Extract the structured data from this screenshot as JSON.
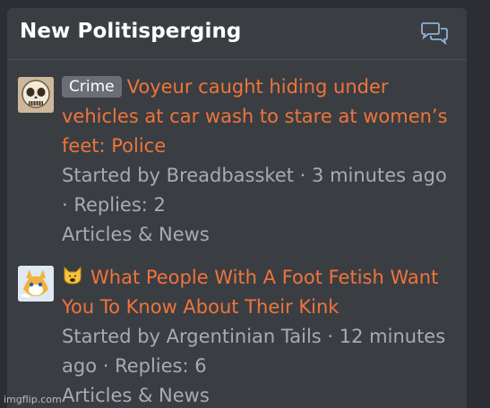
{
  "widget": {
    "title": "New Politisperging",
    "header_icon": "chat-bubbles-icon"
  },
  "threads": [
    {
      "avatar_icon": "skull-avatar-icon",
      "prefix": "Crime",
      "title": "Voyeur caught hiding under vehicles at car wash to stare at women’s feet: Police",
      "meta": "Started by Breadbassket · 3 minutes ago · Replies: 2",
      "forum": "Articles & News"
    },
    {
      "avatar_icon": "fox-character-avatar-icon",
      "emoji_icon": "cat-face-emoji-icon",
      "title": "What People With A Foot Fetish Want You To Know About Their Kink",
      "meta": "Started by Argentinian Tails · 12 minutes ago · Replies: 6",
      "forum": "Articles & News"
    }
  ],
  "watermark": "imgflip.com",
  "colors": {
    "background": "#2b2e32",
    "panel": "#3a3e43",
    "title_link": "#f0743a",
    "meta_text": "#a8acb2",
    "badge": "#6b6f75"
  }
}
